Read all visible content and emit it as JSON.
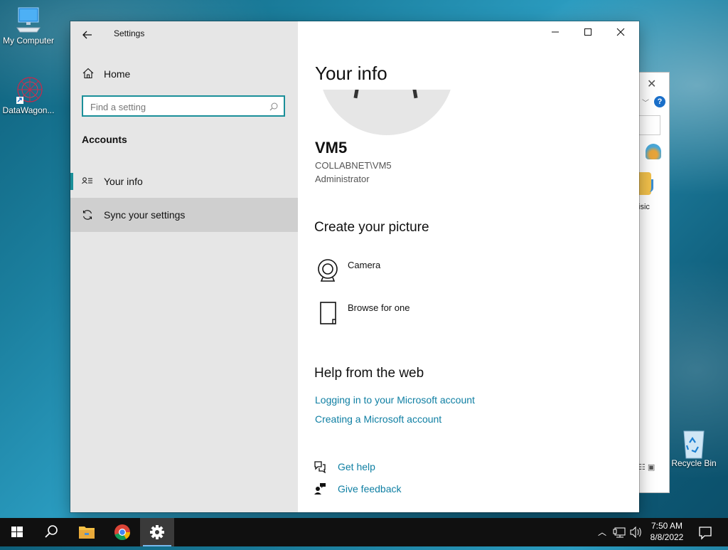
{
  "desktop": {
    "icons": [
      {
        "label": "My Computer",
        "icon": "computer-icon"
      },
      {
        "label": "DataWagon...",
        "icon": "datawagon-icon"
      },
      {
        "label": "Recycle Bin",
        "icon": "recycle-bin-icon"
      }
    ]
  },
  "background_window": {
    "partial_label": "isic"
  },
  "settings": {
    "window_title": "Settings",
    "back_icon": "back-arrow-icon",
    "caption": {
      "minimize": "—",
      "maximize": "☐",
      "close": "✕"
    },
    "sidebar": {
      "home_label": "Home",
      "search_placeholder": "Find a setting",
      "section": "Accounts",
      "items": [
        {
          "label": "Your info",
          "icon": "your-info-icon",
          "selected": true
        },
        {
          "label": "Sync your settings",
          "icon": "sync-icon",
          "hovered": true
        }
      ]
    },
    "content": {
      "title": "Your info",
      "user_name": "VM5",
      "user_domain": "COLLABNET\\VM5",
      "user_role": "Administrator",
      "create_picture_heading": "Create your picture",
      "picture_options": [
        {
          "label": "Camera",
          "icon": "camera-icon"
        },
        {
          "label": "Browse for one",
          "icon": "browse-file-icon"
        }
      ],
      "help_heading": "Help from the web",
      "help_links": [
        "Logging in to your Microsoft account",
        "Creating a Microsoft account"
      ],
      "get_help_label": "Get help",
      "feedback_label": "Give feedback"
    }
  },
  "taskbar": {
    "time": "7:50 AM",
    "date": "8/8/2022",
    "accent_color": "#76b9ed"
  },
  "colors": {
    "link": "#0f7fa3",
    "accent": "#1a8f99",
    "sidebar_bg": "#e6e6e6"
  }
}
